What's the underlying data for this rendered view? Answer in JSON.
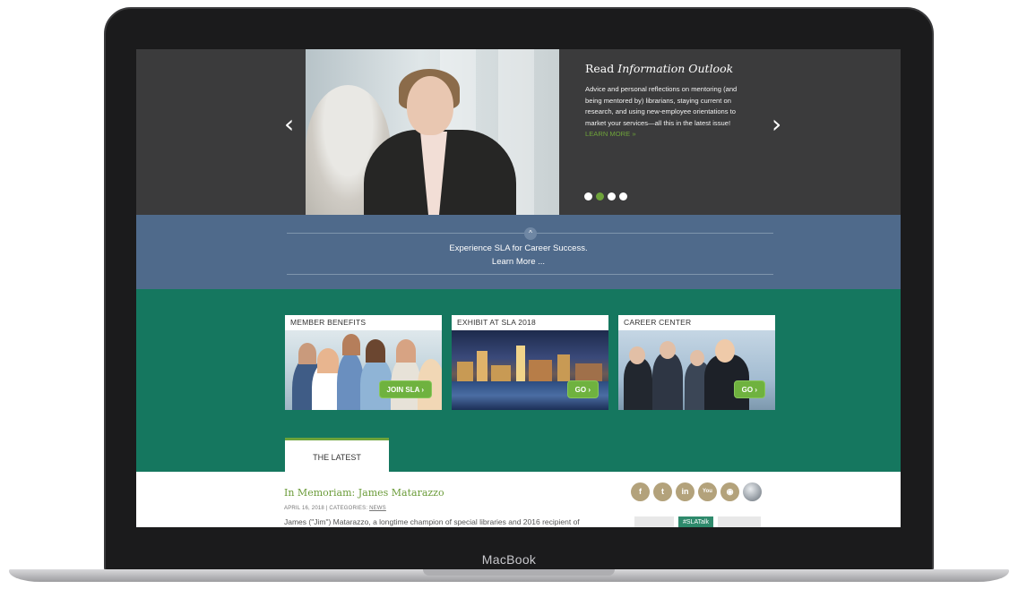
{
  "device": {
    "label": "MacBook"
  },
  "hero": {
    "title_prefix": "Read ",
    "title_em": "Information Outlook",
    "body": "Advice and personal reflections on mentoring (and being mentored by) librarians, staying current on research, and using new-employee orientations to market your services—all this in the latest issue! ",
    "learn_more": "LEARN MORE »",
    "prev_arrow": "‹",
    "next_arrow": "›",
    "slide_count": 4,
    "active_slide": 2
  },
  "band": {
    "up_icon": "^",
    "line1": "Experience SLA for Career Success.",
    "line2": "Learn More ..."
  },
  "cards": [
    {
      "title": "MEMBER BENEFITS",
      "button": "JOIN SLA ›"
    },
    {
      "title": "EXHIBIT AT SLA 2018",
      "button": "GO ›"
    },
    {
      "title": "CAREER CENTER",
      "button": "GO ›"
    }
  ],
  "latest": {
    "tab_label": "THE LATEST",
    "post_title": "In Memoriam: James Matarazzo",
    "post_meta_prefix": "APRIL 16, 2018 | CATEGORIES: ",
    "post_category": "NEWS",
    "post_excerpt": "James (\"Jim\") Matarazzo, a longtime champion of special libraries and 2016 recipient of"
  },
  "social": [
    {
      "icon": "facebook-icon",
      "glyph": "f"
    },
    {
      "icon": "twitter-icon",
      "glyph": "t"
    },
    {
      "icon": "linkedin-icon",
      "glyph": "in"
    },
    {
      "icon": "youtube-icon",
      "glyph": "You"
    },
    {
      "icon": "rss-icon",
      "glyph": "◉"
    },
    {
      "icon": "globe-icon",
      "glyph": ""
    }
  ],
  "tags": [
    "",
    "#SLATalk",
    ""
  ],
  "colors": {
    "hero_bg": "#3b3b3c",
    "band_bg": "#4f6a8b",
    "green_bg": "#15775f",
    "accent_green": "#6ea33a",
    "social_bg": "#b3a27b"
  }
}
